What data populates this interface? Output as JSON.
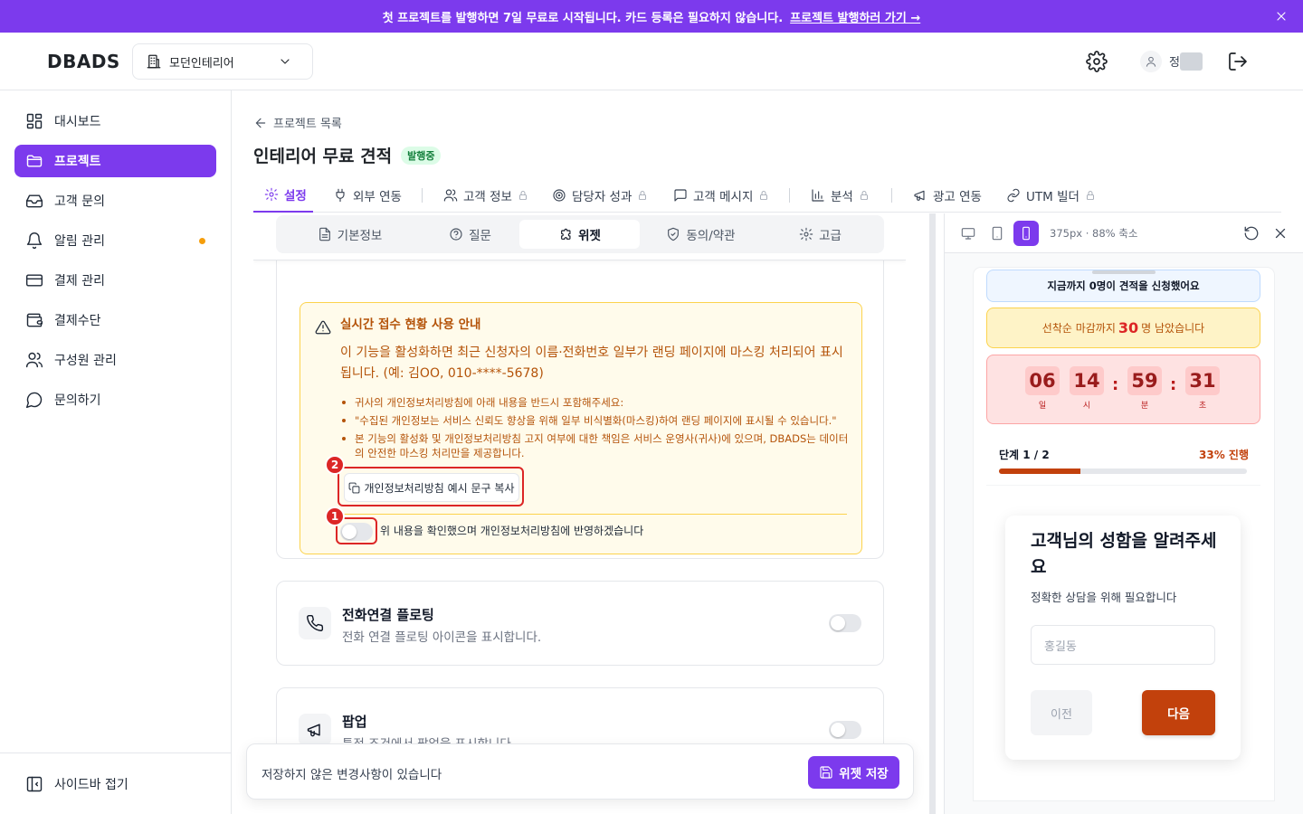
{
  "banner": {
    "text": "첫 프로젝트를 발행하면 7일 무료로 시작됩니다. 카드 등록은 필요하지 않습니다.",
    "link": "프로젝트 발행하러 가기 →"
  },
  "header": {
    "logo": "DBADS",
    "project_select": "모던인테리어",
    "user_initial": "정"
  },
  "sidebar": {
    "items": [
      {
        "label": "대시보드",
        "icon": "dashboard-icon"
      },
      {
        "label": "프로젝트",
        "icon": "folder-icon",
        "active": true
      },
      {
        "label": "고객 문의",
        "icon": "inbox-icon"
      },
      {
        "label": "알림 관리",
        "icon": "bell-icon",
        "dot": true
      },
      {
        "label": "결제 관리",
        "icon": "credit-card-icon"
      },
      {
        "label": "결제수단",
        "icon": "wallet-icon"
      },
      {
        "label": "구성원 관리",
        "icon": "users-icon"
      },
      {
        "label": "문의하기",
        "icon": "chat-icon"
      }
    ],
    "collapse": "사이드바 접기"
  },
  "main": {
    "back": "프로젝트 목록",
    "title": "인테리어 무료 견적",
    "status": "발행중",
    "tabs": [
      {
        "label": "설정",
        "active": true
      },
      {
        "label": "외부 연동"
      },
      {
        "label": "고객 정보",
        "locked": true
      },
      {
        "label": "담당자 성과",
        "locked": true
      },
      {
        "label": "고객 메시지",
        "locked": true
      },
      {
        "label": "분석",
        "locked": true
      },
      {
        "label": "광고 연동"
      },
      {
        "label": "UTM 빌더",
        "locked": true
      }
    ],
    "subtabs": [
      {
        "label": "기본정보"
      },
      {
        "label": "질문"
      },
      {
        "label": "위젯",
        "active": true
      },
      {
        "label": "동의/약관"
      },
      {
        "label": "고급"
      }
    ]
  },
  "notice": {
    "title": "실시간 접수 현황 사용 안내",
    "body": "이 기능을 활성화하면 최근 신청자의 이름·전화번호 일부가 랜딩 페이지에 마스킹 처리되어 표시됩니다. (예: 김OO, 010-****-5678)",
    "bullets": [
      "귀사의 개인정보처리방침에 아래 내용을 반드시 포함해주세요:",
      "\"수집된 개인정보는 서비스 신뢰도 향상을 위해 일부 비식별화(마스킹)하여 랜딩 페이지에 표시될 수 있습니다.\"",
      "본 기능의 활성화 및 개인정보처리방침 고지 여부에 대한 책임은 서비스 운영사(귀사)에 있으며, DBADS는 데이터의 안전한 마스킹 처리만을 제공합니다."
    ],
    "copy_button": "개인정보처리방침 예시 문구 복사",
    "confirm_label": "위 내용을 확인했으며 개인정보처리방침에 반영하겠습니다",
    "confirm_on": false,
    "marker_1": "1",
    "marker_2": "2"
  },
  "features": [
    {
      "title": "전화연결 플로팅",
      "desc": "전화 연결 플로팅 아이콘을 표시합니다.",
      "on": false
    },
    {
      "title": "팝업",
      "desc": "특정 조건에서 팝업을 표시합니다.",
      "on": false
    }
  ],
  "savebar": {
    "message": "저장하지 않은 변경사항이 있습니다",
    "button": "위젯 저장"
  },
  "preview": {
    "size": "375px · 88% 축소",
    "live": "지금까지 0명이 견적을 신청했어요",
    "deadline_pre": "선착순 마감까지",
    "deadline_num": "30",
    "deadline_post": "명 남았습니다",
    "countdown": [
      {
        "value": "06",
        "unit": "일"
      },
      {
        "value": "14",
        "unit": "시"
      },
      {
        "value": "59",
        "unit": "분"
      },
      {
        "value": "31",
        "unit": "초"
      }
    ],
    "step": "단계 1 / 2",
    "percent_label": "33% 진행",
    "progress": 0.33,
    "question": "고객님의 성함을 알려주세요",
    "question_sub": "정확한 상담을 위해 필요합니다",
    "input_placeholder": "홍길동",
    "prev": "이전",
    "next": "다음"
  },
  "colors": {
    "accent": "#7c3aed",
    "preview_cta": "#c2410c",
    "warning_text": "#b45309",
    "highlight": "#dc2626"
  }
}
